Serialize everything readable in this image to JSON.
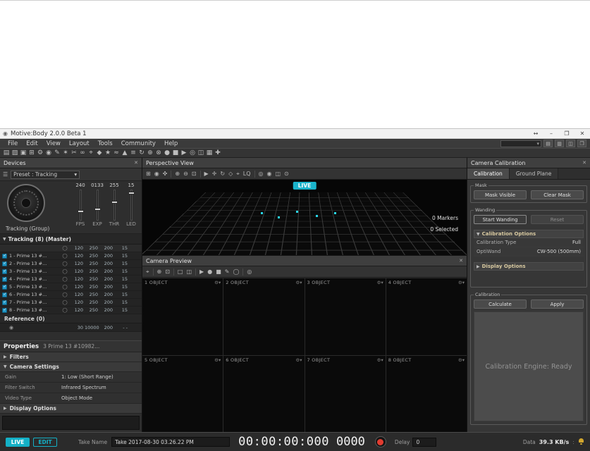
{
  "icons": {
    "app": "◉",
    "close": "✕",
    "chevron_down": "▾",
    "caret_down": "▼",
    "caret_right": "▶",
    "list": "☰",
    "circle": "◯",
    "camera": "◉",
    "gear_menu": "⚙▾",
    "plus_marker": "+"
  },
  "window": {
    "title": "Motive:Body 2.0.0 Beta 1",
    "controls": [
      {
        "name": "window-dock-button",
        "glyph": "↔"
      },
      {
        "name": "window-minimize-button",
        "glyph": "–"
      },
      {
        "name": "window-maximize-button",
        "glyph": "❐"
      },
      {
        "name": "window-close-button",
        "glyph": "✕"
      }
    ]
  },
  "menu": {
    "items": [
      "File",
      "Edit",
      "View",
      "Layout",
      "Tools",
      "Community",
      "Help"
    ],
    "right_icons": [
      {
        "name": "layout-save-icon",
        "glyph": "▤"
      },
      {
        "name": "layout-load-icon",
        "glyph": "▥"
      },
      {
        "name": "docking-icon",
        "glyph": "◫"
      },
      {
        "name": "help-panel-icon",
        "glyph": "❒"
      }
    ]
  },
  "main_toolbar": {
    "icons": [
      {
        "name": "new-take-icon",
        "glyph": "▤"
      },
      {
        "name": "open-take-icon",
        "glyph": "▨"
      },
      {
        "name": "save-icon",
        "glyph": "▣"
      },
      {
        "name": "layout-icon",
        "glyph": "⊞"
      },
      {
        "name": "settings-icon",
        "glyph": "⚙"
      },
      {
        "name": "camera-icon",
        "glyph": "◉"
      },
      {
        "name": "edit-tools-icon",
        "glyph": "✎"
      },
      {
        "name": "wand-icon",
        "glyph": "✶"
      },
      {
        "name": "cut-icon",
        "glyph": "✂"
      },
      {
        "name": "link-icon",
        "glyph": "∞"
      },
      {
        "name": "marker-icon",
        "glyph": "⌖"
      },
      {
        "name": "rigid-body-icon",
        "glyph": "◆"
      },
      {
        "name": "skeleton-icon",
        "glyph": "★"
      },
      {
        "name": "trajectory-icon",
        "glyph": "≈"
      },
      {
        "name": "graph-icon",
        "glyph": "▲"
      },
      {
        "name": "list-view-icon",
        "glyph": "≡"
      },
      {
        "name": "refresh-icon",
        "glyph": "↻"
      },
      {
        "name": "expand-icon",
        "glyph": "⊕"
      },
      {
        "name": "remove-icon",
        "glyph": "⊗"
      },
      {
        "name": "record-icon",
        "glyph": "●"
      },
      {
        "name": "stop-icon",
        "glyph": "■"
      },
      {
        "name": "play-icon",
        "glyph": "▶"
      },
      {
        "name": "probe-icon",
        "glyph": "◎"
      },
      {
        "name": "video-pane-icon",
        "glyph": "◫"
      },
      {
        "name": "data-pane-icon",
        "glyph": "▦"
      },
      {
        "name": "add-icon",
        "glyph": "✚"
      }
    ]
  },
  "devices": {
    "title": "Devices",
    "preset": "Preset : Tracking",
    "group_label": "Tracking (Group)",
    "sliders": [
      {
        "value": "240",
        "label": "FPS"
      },
      {
        "value": "0133",
        "label": "EXP"
      },
      {
        "value": "255",
        "label": "THR"
      },
      {
        "value": "15",
        "label": "LED"
      }
    ],
    "tracking_header": "Tracking (8) (Master)",
    "group_values": {
      "fps": "120",
      "exp": "250",
      "thr": "200",
      "led": "15"
    },
    "rows": [
      {
        "name": "1 - Prime 13 #...",
        "fps": "120",
        "exp": "250",
        "thr": "200",
        "led": "15"
      },
      {
        "name": "2 - Prime 13 #...",
        "fps": "120",
        "exp": "250",
        "thr": "200",
        "led": "15"
      },
      {
        "name": "3 - Prime 13 #...",
        "fps": "120",
        "exp": "250",
        "thr": "200",
        "led": "15"
      },
      {
        "name": "4 - Prime 13 #...",
        "fps": "120",
        "exp": "250",
        "thr": "200",
        "led": "15"
      },
      {
        "name": "5 - Prime 13 #...",
        "fps": "120",
        "exp": "250",
        "thr": "200",
        "led": "15"
      },
      {
        "name": "6 - Prime 13 #...",
        "fps": "120",
        "exp": "250",
        "thr": "200",
        "led": "15"
      },
      {
        "name": "7 - Prime 13 #...",
        "fps": "120",
        "exp": "250",
        "thr": "200",
        "led": "15"
      },
      {
        "name": "8 - Prime 13 #...",
        "fps": "120",
        "exp": "250",
        "thr": "200",
        "led": "15"
      }
    ],
    "reference_header": "Reference (0)",
    "reference_row": {
      "v1": "30",
      "v2": "10000",
      "v3": "200",
      "v4": "- -"
    }
  },
  "properties": {
    "title": "Properties",
    "subtitle": "3 Prime 13 #10982...",
    "sections": {
      "filters": "Filters",
      "camera_settings": "Camera Settings",
      "display_options": "Display Options"
    },
    "settings": [
      {
        "label": "Gain",
        "value": "1: Low (Short Range)"
      },
      {
        "label": "Filter Switch",
        "value": "Infrared Spectrum"
      },
      {
        "label": "Video Type",
        "value": "Object Mode"
      }
    ]
  },
  "perspective": {
    "title": "Perspective View",
    "live_badge": "LIVE",
    "markers_count": "0 Markers",
    "selected_count": "0 Selected",
    "toolbar_groups": [
      [
        {
          "name": "grid-icon",
          "glyph": "⊞"
        },
        {
          "name": "screenshot-icon",
          "glyph": "◉"
        },
        {
          "name": "pan-view-icon",
          "glyph": "✜"
        }
      ],
      [
        {
          "name": "zoom-in-icon",
          "glyph": "⊕"
        },
        {
          "name": "zoom-out-icon",
          "glyph": "⊖"
        },
        {
          "name": "zoom-fit-icon",
          "glyph": "⊡"
        }
      ],
      [
        {
          "name": "select-tool-icon",
          "glyph": "▶"
        },
        {
          "name": "translate-tool-icon",
          "glyph": "✛"
        },
        {
          "name": "rotate-tool-icon",
          "glyph": "↻"
        },
        {
          "name": "scale-tool-icon",
          "glyph": "◇"
        },
        {
          "name": "marker-tool-icon",
          "glyph": "⌖"
        },
        {
          "name": "quality-toggle",
          "glyph": "LQ"
        }
      ],
      [
        {
          "name": "visual-aids-icon",
          "glyph": "◎"
        },
        {
          "name": "camera-overlay-icon",
          "glyph": "◉"
        },
        {
          "name": "video-overlay-icon",
          "glyph": "◫"
        },
        {
          "name": "eye-icon",
          "glyph": "⊙"
        }
      ]
    ]
  },
  "camera_preview": {
    "title": "Camera Preview",
    "toolbar_groups": [
      [
        {
          "name": "pointer-icon",
          "glyph": "⌖"
        }
      ],
      [
        {
          "name": "zoom-in-icon",
          "glyph": "⊕"
        },
        {
          "name": "zoom-fit-icon",
          "glyph": "⊡"
        }
      ],
      [
        {
          "name": "layout-single-icon",
          "glyph": "□"
        },
        {
          "name": "layout-grid-icon",
          "glyph": "◫"
        }
      ],
      [
        {
          "name": "select-tool-icon",
          "glyph": "▶"
        },
        {
          "name": "mask-circle-icon",
          "glyph": "●"
        },
        {
          "name": "mask-square-icon",
          "glyph": "■"
        },
        {
          "name": "mask-pen-icon",
          "glyph": "✎"
        },
        {
          "name": "mask-ellipse-icon",
          "glyph": "◯"
        }
      ],
      [
        {
          "name": "eye-icon",
          "glyph": "◎"
        }
      ]
    ],
    "cells": [
      {
        "label": "1 OBJECT"
      },
      {
        "label": "2 OBJECT"
      },
      {
        "label": "3 OBJECT"
      },
      {
        "label": "4 OBJECT"
      },
      {
        "label": "5 OBJECT"
      },
      {
        "label": "6 OBJECT"
      },
      {
        "label": "7 OBJECT"
      },
      {
        "label": "8 OBJECT"
      }
    ]
  },
  "calibration": {
    "panel_title": "Camera Calibration",
    "tabs": [
      {
        "label": "Calibration"
      },
      {
        "label": "Ground Plane"
      }
    ],
    "mask": {
      "title": "Mask",
      "visible_button": "Mask Visible",
      "clear_button": "Clear Mask"
    },
    "wanding": {
      "title": "Wanding",
      "start_button": "Start Wanding",
      "reset_button": "Reset",
      "options_header": "Calibration Options",
      "options": [
        {
          "label": "Calibration Type",
          "value": "Full"
        },
        {
          "label": "OptiWand",
          "value": "CW-500 (500mm)"
        }
      ],
      "display_options_header": "Display Options"
    },
    "calc": {
      "title": "Calibration",
      "calculate_button": "Calculate",
      "apply_button": "Apply",
      "engine_status": "Calibration Engine: Ready"
    }
  },
  "status_bar": {
    "live_button": "LIVE",
    "edit_button": "EDIT",
    "take_name_label": "Take Name",
    "take_name_value": "Take 2017-08-30 03.26.22 PM",
    "timecode": "00:00:00:000",
    "frame_counter": "0000",
    "delay_label": "Delay",
    "delay_value": "0",
    "data_label": "Data",
    "data_rate": "39.3 KB/s",
    "separator": ":"
  }
}
